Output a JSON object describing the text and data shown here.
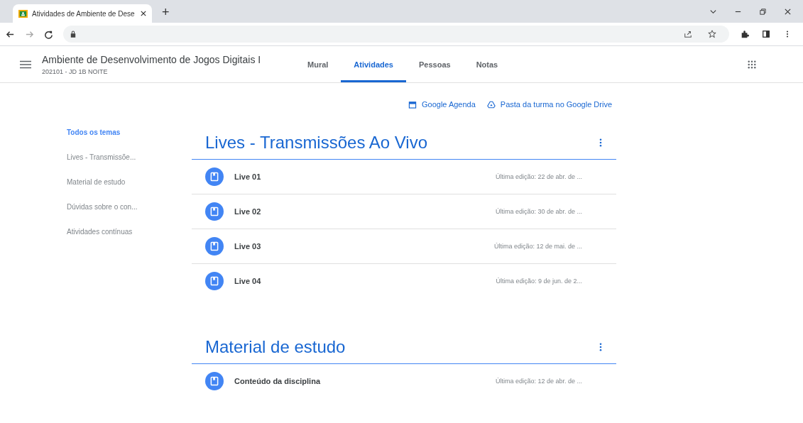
{
  "browser": {
    "tab_title": "Atividades de Ambiente de Dese",
    "new_tab": "+"
  },
  "header": {
    "course_title": "Ambiente de Desenvolvimento de Jogos Digitais I",
    "course_subtitle": "202101 - JD 1B NOITE",
    "tabs": [
      {
        "label": "Mural",
        "selected": false
      },
      {
        "label": "Atividades",
        "selected": true
      },
      {
        "label": "Pessoas",
        "selected": false
      },
      {
        "label": "Notas",
        "selected": false
      }
    ]
  },
  "links": [
    {
      "kind": "calendar",
      "label": "Google Agenda"
    },
    {
      "kind": "drive",
      "label": "Pasta da turma no Google Drive"
    }
  ],
  "topics": [
    {
      "label": "Todos os temas",
      "selected": true
    },
    {
      "label": "Lives - Transmissõe...",
      "selected": false
    },
    {
      "label": "Material de estudo",
      "selected": false
    },
    {
      "label": "Dúvidas sobre o con...",
      "selected": false
    },
    {
      "label": "Atividades contínuas",
      "selected": false
    }
  ],
  "sections": [
    {
      "title": "Lives - Transmissões Ao Vivo",
      "items": [
        {
          "title": "Live 01",
          "edited": "Última edição: 22 de abr. de ..."
        },
        {
          "title": "Live 02",
          "edited": "Última edição: 30 de abr. de ..."
        },
        {
          "title": "Live 03",
          "edited": "Última edição: 12 de mai. de ..."
        },
        {
          "title": "Live 04",
          "edited": "Última edição: 9 de jun. de 2..."
        }
      ]
    },
    {
      "title": "Material de estudo",
      "items": [
        {
          "title": "Conteúdo da disciplina",
          "edited": "Última edição: 12 de abr. de ..."
        }
      ]
    }
  ]
}
